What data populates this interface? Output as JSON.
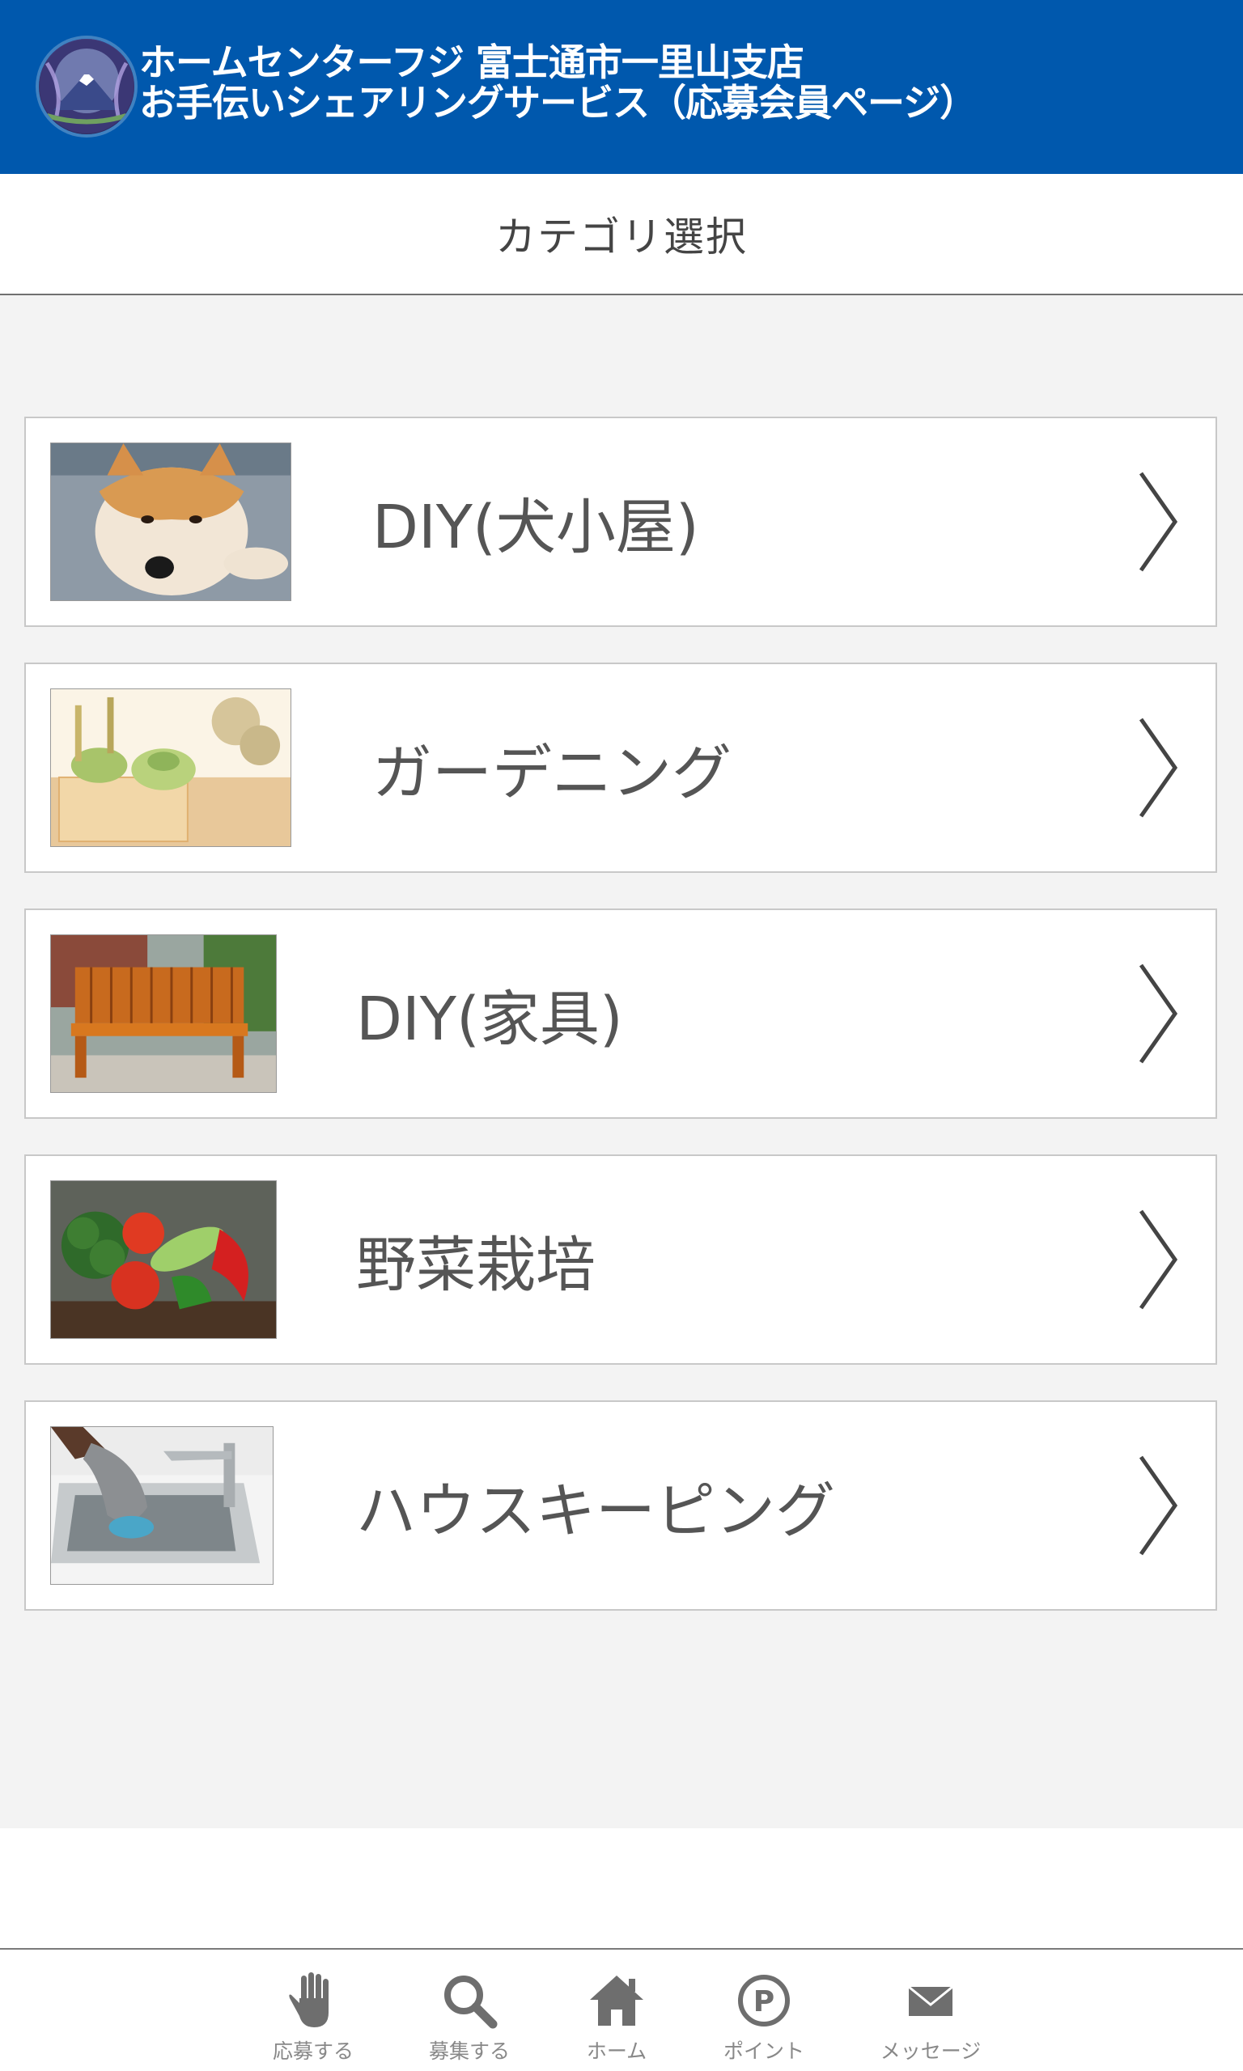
{
  "header": {
    "line1": "ホームセンターフジ 富士通市一里山支店",
    "line2": "お手伝いシェアリングサービス（応募会員ページ）"
  },
  "page_title": "カテゴリ選択",
  "categories": [
    {
      "label": "DIY(犬小屋)",
      "image": "shiba-dog-photo"
    },
    {
      "label": "ガーデニング",
      "image": "succulent-plants-photo"
    },
    {
      "label": "DIY(家具)",
      "image": "wooden-bench-photo"
    },
    {
      "label": "野菜栽培",
      "image": "vegetables-photo"
    },
    {
      "label": "ハウスキーピング",
      "image": "sink-cleaning-photo"
    }
  ],
  "bottom_nav": [
    {
      "label": "応募する",
      "icon": "hand-icon"
    },
    {
      "label": "募集する",
      "icon": "search-icon"
    },
    {
      "label": "ホーム",
      "icon": "home-icon"
    },
    {
      "label": "ポイント",
      "icon": "point-icon"
    },
    {
      "label": "メッセージ",
      "icon": "mail-icon"
    }
  ],
  "colors": {
    "header_bg": "#0058ad",
    "content_bg": "#f3f3f3",
    "text": "#555555"
  }
}
